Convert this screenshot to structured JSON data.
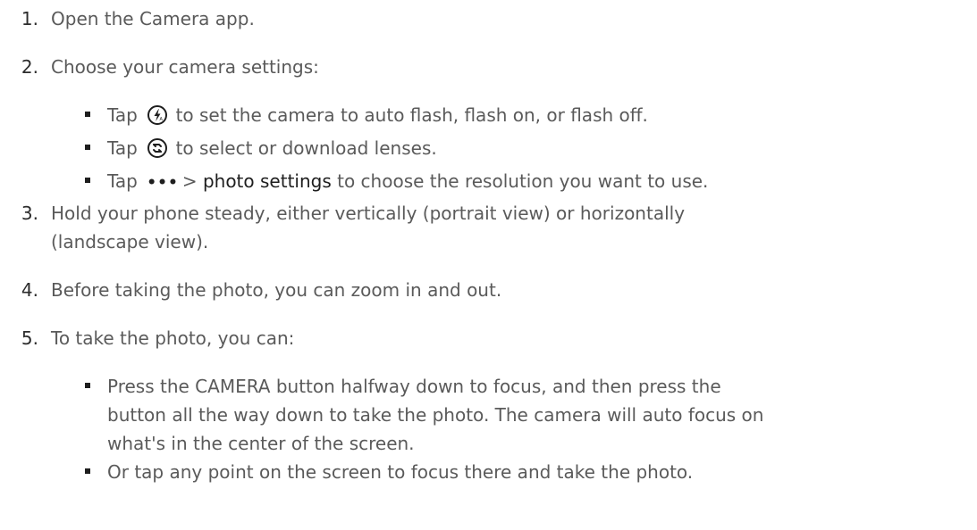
{
  "steps": [
    {
      "num": "1.",
      "text": "Open the Camera app."
    },
    {
      "num": "2.",
      "text": "Choose your camera settings:",
      "sub": [
        {
          "pre": "Tap",
          "icon": "flash-icon",
          "post": "to set the camera to auto flash, flash on, or flash off."
        },
        {
          "pre": "Tap",
          "icon": "lenses-icon",
          "post": "to select or download lenses."
        },
        {
          "pre": "Tap",
          "dots": "•••",
          "gt": ">",
          "bold": "photo settings",
          "post": "to choose the resolution you want to use."
        }
      ]
    },
    {
      "num": "3.",
      "line1": "Hold your phone steady, either vertically (portrait view) or horizontally",
      "line2": "(landscape view)."
    },
    {
      "num": "4.",
      "text": "Before taking the photo, you can zoom in and out."
    },
    {
      "num": "5.",
      "text": "To take the photo, you can:",
      "sub": [
        {
          "lines": [
            "Press the CAMERA button halfway down to focus, and then press the",
            "button all the way down to take the photo. The camera will auto focus on",
            "what's in the center of the screen."
          ]
        },
        {
          "text": "Or tap any point on the screen to focus there and take the photo."
        }
      ]
    }
  ]
}
